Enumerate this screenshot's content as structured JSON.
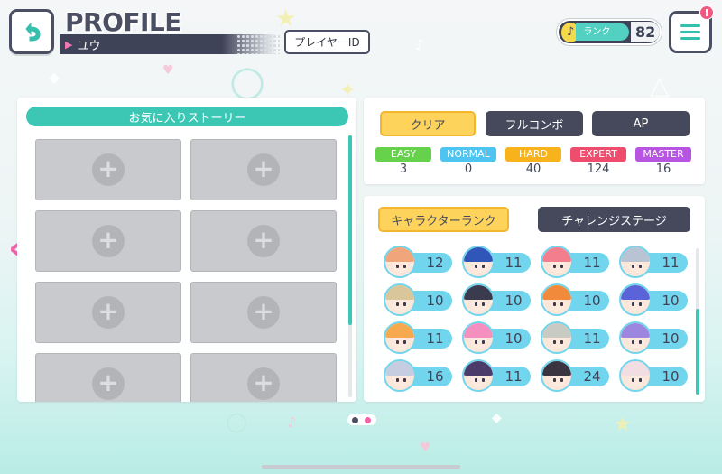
{
  "header": {
    "title": "PROFILE",
    "username": "ユウ",
    "player_id_label": "プレイヤーID"
  },
  "rank": {
    "label": "ランク",
    "value": "82"
  },
  "notification": {
    "badge": "!"
  },
  "favorites": {
    "title": "お気に入りストーリー",
    "add_symbol": "+"
  },
  "clear_stats": {
    "tabs": [
      {
        "label": "クリア",
        "active": true
      },
      {
        "label": "フルコンボ",
        "active": false
      },
      {
        "label": "AP",
        "active": false
      }
    ],
    "difficulties": [
      {
        "name": "EASY",
        "value": "3",
        "color": "#66d14a"
      },
      {
        "name": "NORMAL",
        "value": "0",
        "color": "#4ec4f0"
      },
      {
        "name": "HARD",
        "value": "40",
        "color": "#f8b21c"
      },
      {
        "name": "EXPERT",
        "value": "124",
        "color": "#ee4d6e"
      },
      {
        "name": "MASTER",
        "value": "16",
        "color": "#b754e2"
      }
    ]
  },
  "character_rank": {
    "tabs": [
      {
        "label": "キャラクターランク",
        "active": true
      },
      {
        "label": "チャレンジステージ",
        "active": false
      }
    ],
    "characters": [
      {
        "rank": "12",
        "hair": "#f0a67a"
      },
      {
        "rank": "11",
        "hair": "#2f56b8"
      },
      {
        "rank": "11",
        "hair": "#f27e8e"
      },
      {
        "rank": "11",
        "hair": "#b8c4d4"
      },
      {
        "rank": "10",
        "hair": "#d9c79b"
      },
      {
        "rank": "10",
        "hair": "#3b3b4f"
      },
      {
        "rank": "10",
        "hair": "#f28a3c"
      },
      {
        "rank": "10",
        "hair": "#5a63d8"
      },
      {
        "rank": "11",
        "hair": "#f6a94e"
      },
      {
        "rank": "10",
        "hair": "#f58fbf"
      },
      {
        "rank": "11",
        "hair": "#c9cbc3"
      },
      {
        "rank": "10",
        "hair": "#9d86e0"
      },
      {
        "rank": "16",
        "hair": "#c6cde0"
      },
      {
        "rank": "11",
        "hair": "#4a3b6b"
      },
      {
        "rank": "24",
        "hair": "#3a3440"
      },
      {
        "rank": "10",
        "hair": "#f1dde2"
      }
    ]
  }
}
